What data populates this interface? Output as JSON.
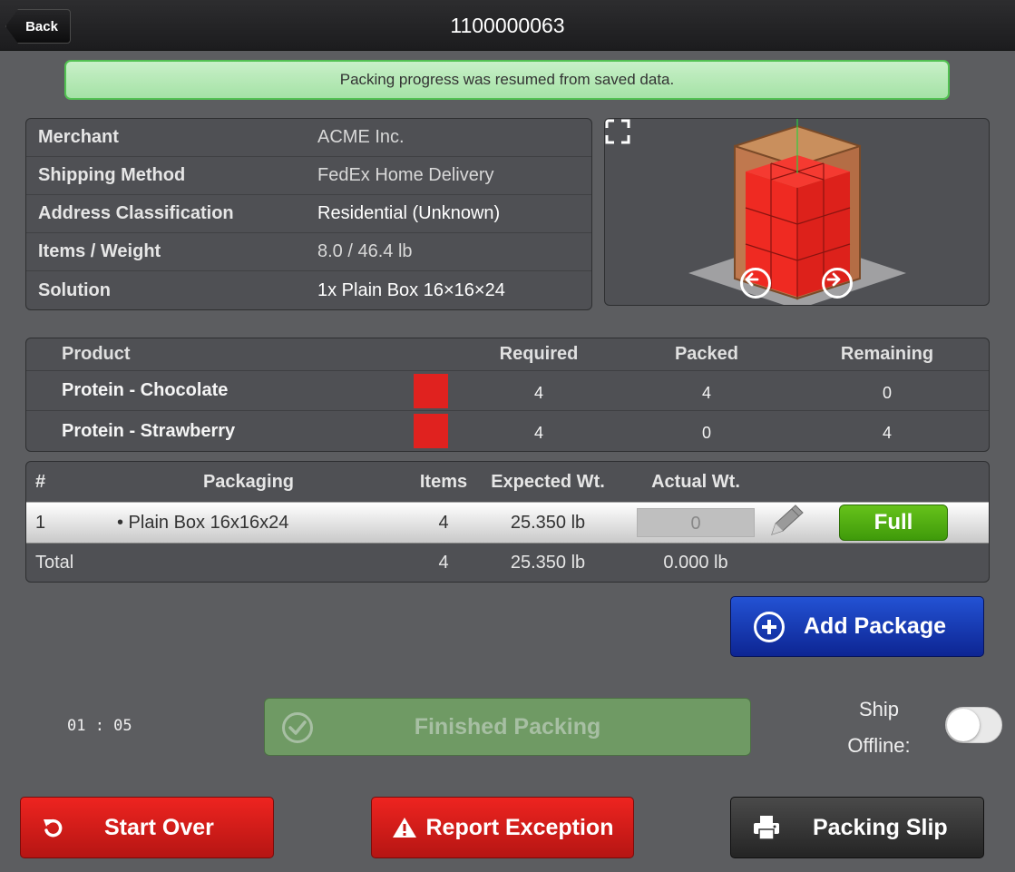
{
  "header": {
    "back_label": "Back",
    "title": "1100000063"
  },
  "banner": {
    "message": "Packing progress was resumed from saved data."
  },
  "info": {
    "rows": [
      {
        "label": "Merchant",
        "value": "ACME Inc."
      },
      {
        "label": "Shipping Method",
        "value": "FedEx Home Delivery"
      },
      {
        "label": "Address Classification",
        "value": "Residential (Unknown)"
      },
      {
        "label": "Items / Weight",
        "value": "8.0 / 46.4 lb"
      },
      {
        "label": "Solution",
        "value": "1x Plain Box 16×16×24"
      }
    ]
  },
  "viewer": {
    "prev_icon": "arrow-left-circle-icon",
    "next_icon": "arrow-right-circle-icon",
    "fullscreen_icon": "fullscreen-icon"
  },
  "products": {
    "headers": {
      "product": "Product",
      "required": "Required",
      "packed": "Packed",
      "remaining": "Remaining"
    },
    "rows": [
      {
        "name": "Protein - Chocolate",
        "color": "#e0221f",
        "required": "4",
        "packed": "4",
        "remaining": "0"
      },
      {
        "name": "Protein - Strawberry",
        "color": "#e0221f",
        "required": "4",
        "packed": "0",
        "remaining": "4"
      }
    ]
  },
  "packages": {
    "headers": {
      "num": "#",
      "packaging": "Packaging",
      "items": "Items",
      "expected": "Expected Wt.",
      "actual": "Actual Wt."
    },
    "rows": [
      {
        "num": "1",
        "packaging": "• Plain Box 16x16x24",
        "items": "4",
        "expected": "25.350 lb",
        "actual_placeholder": "0",
        "status": "Full"
      }
    ],
    "total": {
      "label": "Total",
      "items": "4",
      "expected": "25.350 lb",
      "actual": "0.000 lb"
    }
  },
  "actions": {
    "add_package": "Add Package",
    "timer": "01 : 05",
    "finished_packing": "Finished Packing",
    "ship_offline_line1": "Ship",
    "ship_offline_line2": "Offline:",
    "ship_offline_enabled": false,
    "start_over": "Start Over",
    "report_exception": "Report Exception",
    "packing_slip": "Packing Slip"
  },
  "colors": {
    "banner_bg": "#b8eab9",
    "full_green": "#52ae12",
    "add_blue": "#1a3fc0",
    "danger_red": "#d81c19",
    "swatch_red": "#e0221f"
  }
}
